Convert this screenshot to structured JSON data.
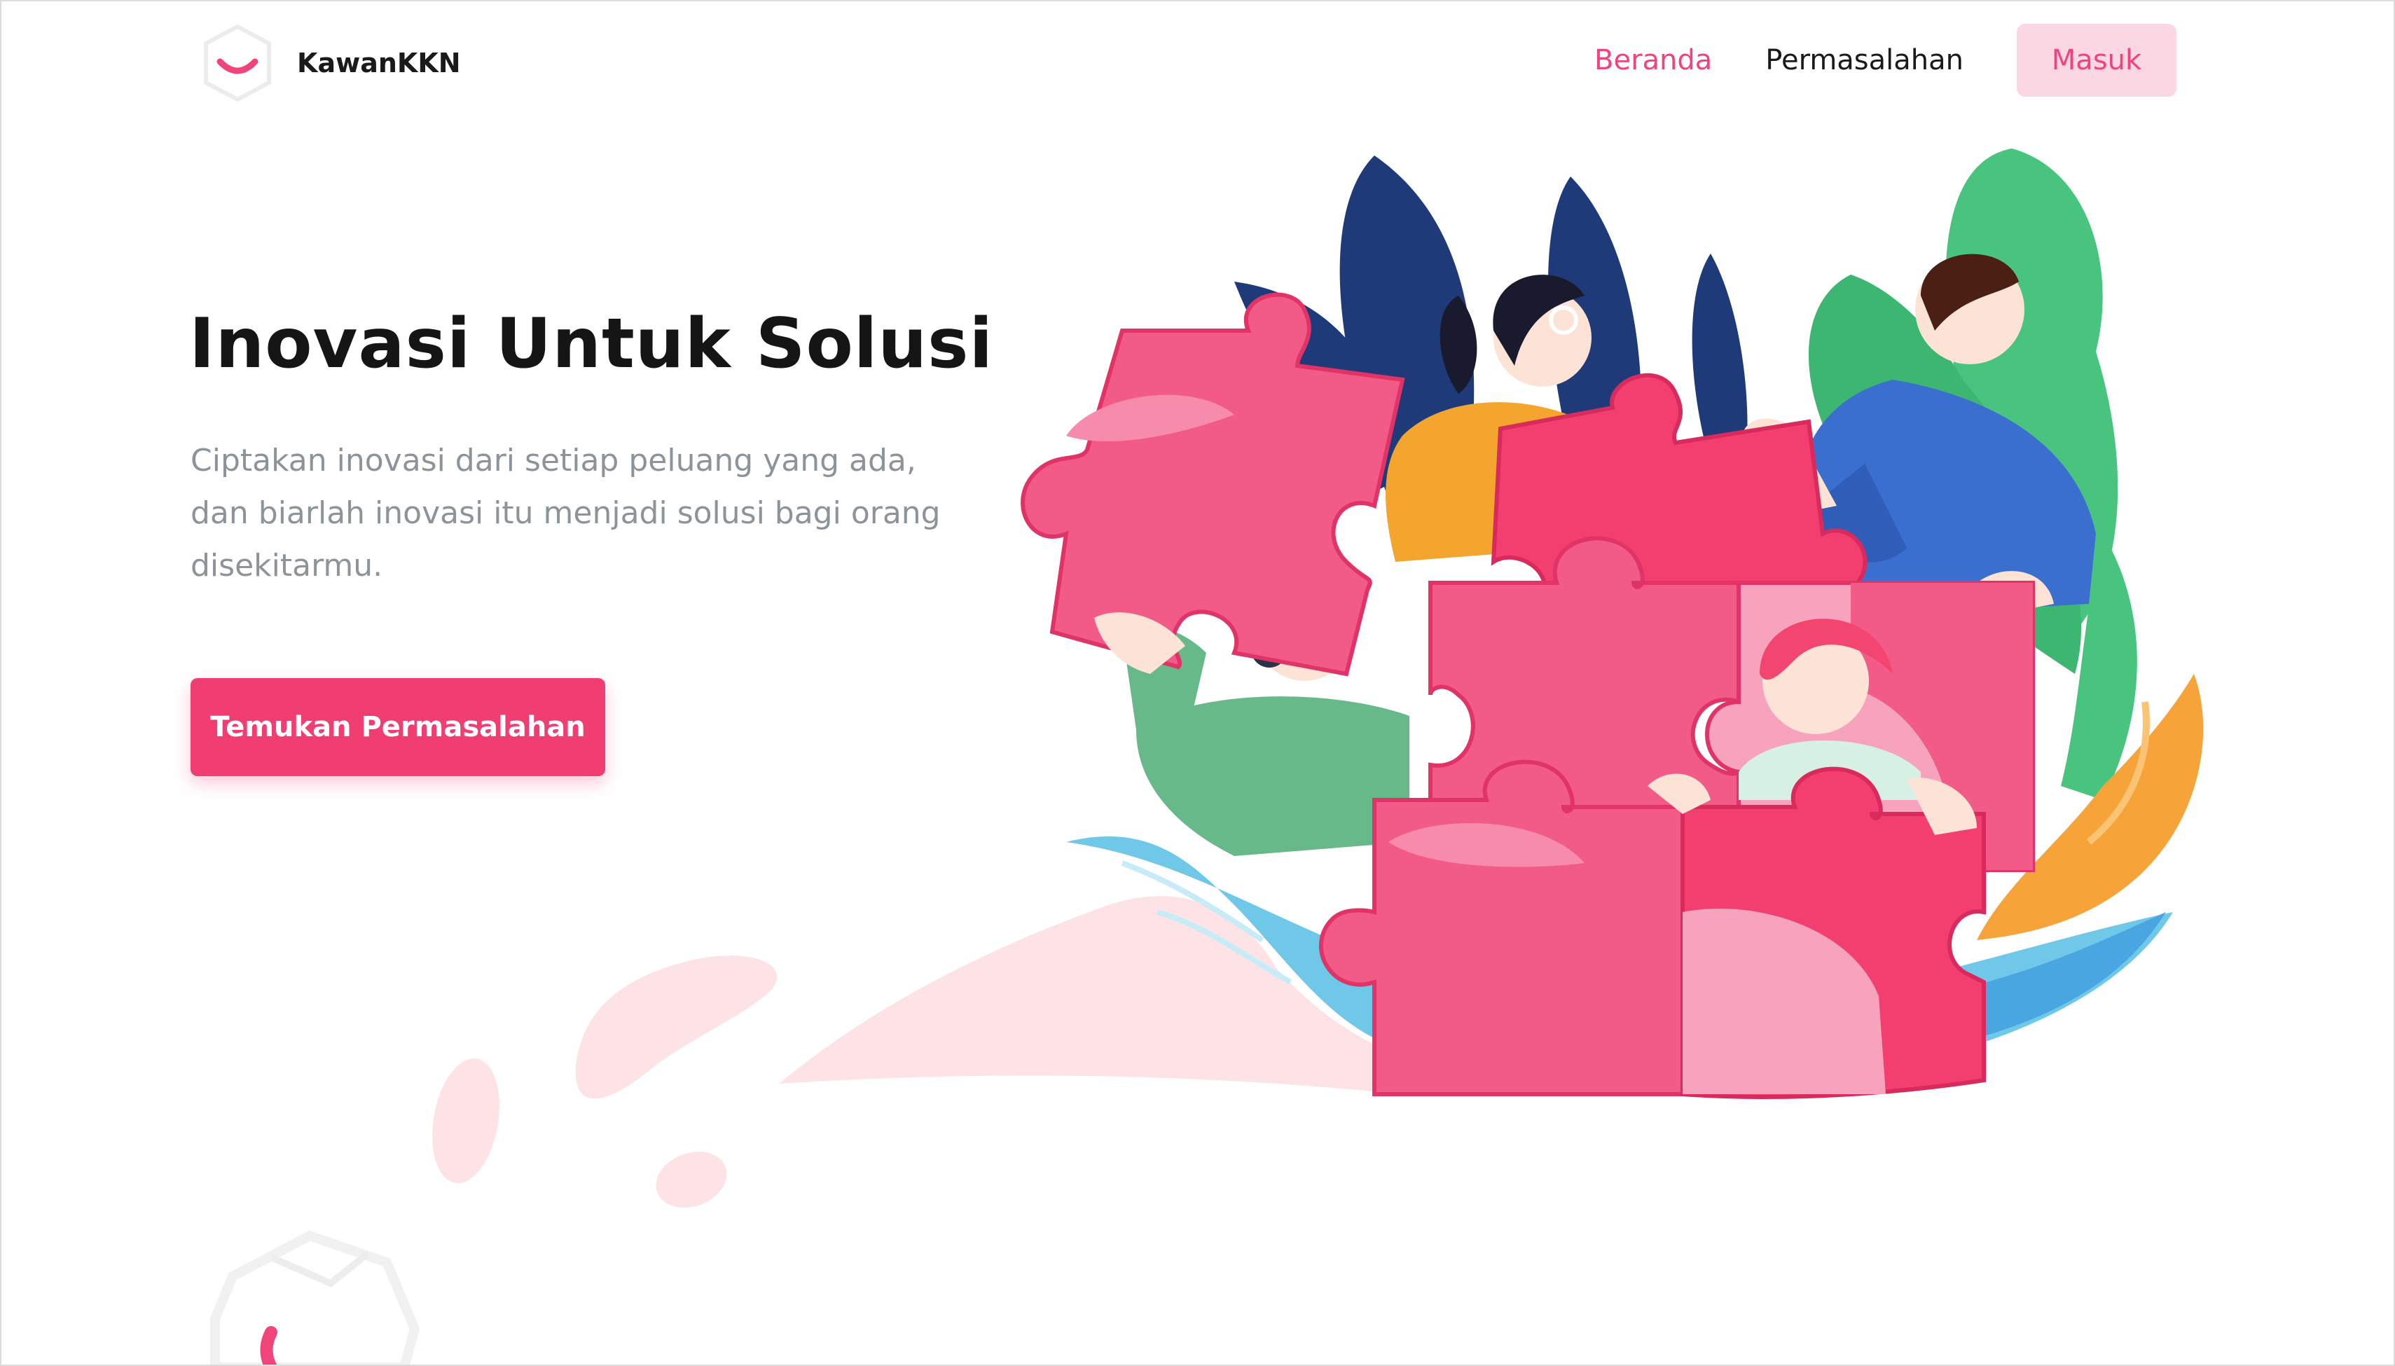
{
  "header": {
    "brand": "KawanKKN",
    "nav": {
      "home": "Beranda",
      "problems": "Permasalahan",
      "login": "Masuk"
    }
  },
  "hero": {
    "title": "Inovasi Untuk Solusi",
    "description": "Ciptakan inovasi dari setiap peluang yang ada, dan biarlah inovasi itu menjadi solusi bagi orang disekitarmu.",
    "cta": "Temukan Permasalahan"
  },
  "theme": {
    "accent": "#f03d72",
    "accent_soft": "#fbd6e3",
    "text_dark": "#151515",
    "text_muted": "#8c949a"
  },
  "icons": {
    "logo": "smile-box-logo",
    "illustration": "team-puzzle-illustration",
    "bottom_decoration": "box-logo-fragment"
  }
}
